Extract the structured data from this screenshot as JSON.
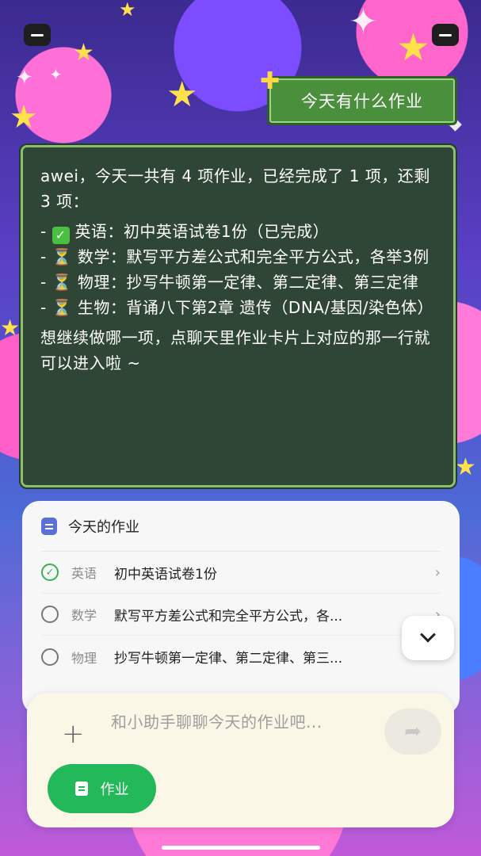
{
  "user_message": "今天有什么作业",
  "assistant_reply": {
    "intro": "awei，今天一共有 4 项作业，已经完成了 1 项，还剩 3 项：",
    "items": [
      {
        "mark": "✅",
        "text": "英语：初中英语试卷1份（已完成）"
      },
      {
        "mark": "⏳",
        "text": "数学：默写平方差公式和完全平方公式，各举3例"
      },
      {
        "mark": "⏳",
        "text": "物理：抄写牛顿第一定律、第二定律、第三定律"
      },
      {
        "mark": "⏳",
        "text": "生物：背诵八下第2章 遗传（DNA/基因/染色体）"
      }
    ],
    "outro": "想继续做哪一项，点聊天里作业卡片上对应的那一行就可以进入啦 ~"
  },
  "homework_card": {
    "title": "今天的作业",
    "rows": [
      {
        "subject": "英语",
        "task": "初中英语试卷1份",
        "done": true
      },
      {
        "subject": "数学",
        "task": "默写平方差公式和完全平方公式，各...",
        "done": false
      },
      {
        "subject": "物理",
        "task": "抄写牛顿第一定律、第二定律、第三...",
        "done": false
      }
    ]
  },
  "composer": {
    "placeholder": "和小助手聊聊今天的作业吧...",
    "homework_button_label": "作业"
  },
  "colors": {
    "chat_bubble_bg": "#4a8f3c",
    "board_bg": "#2f4535",
    "board_border": "#8cbf6a",
    "accent_green": "#23b85a",
    "done_check": "#37b24d"
  }
}
